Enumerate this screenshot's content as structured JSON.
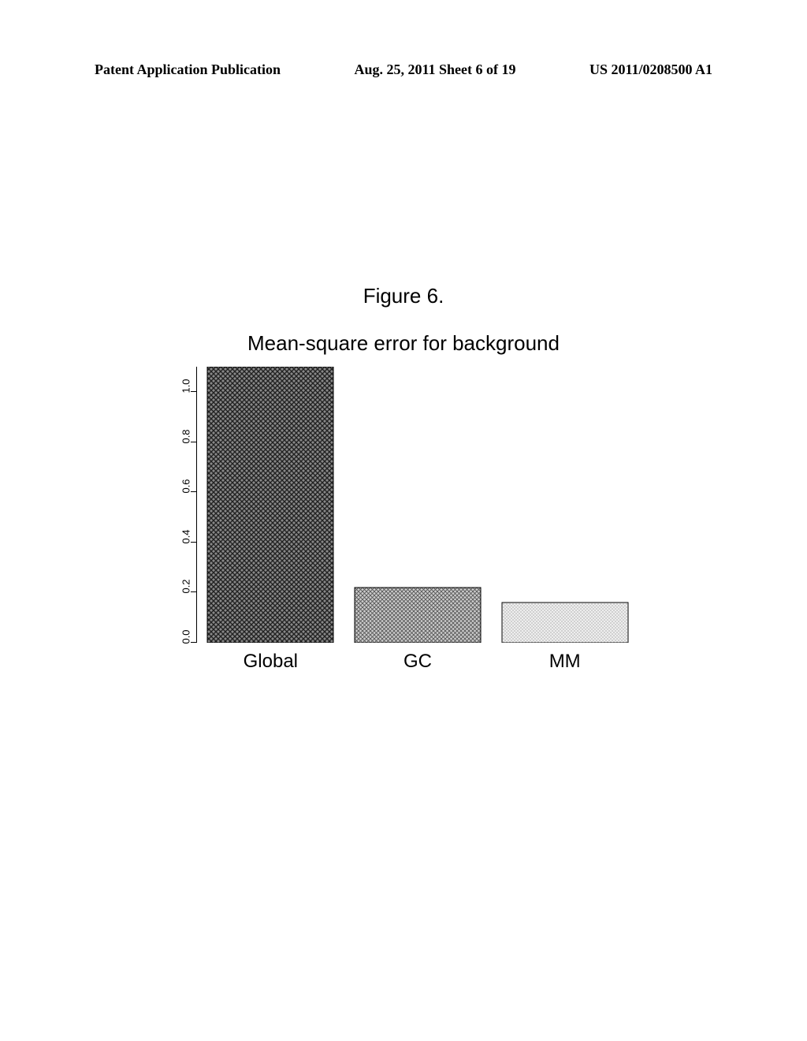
{
  "header": {
    "left": "Patent Application Publication",
    "mid": "Aug. 25, 2011  Sheet 6 of 19",
    "right": "US 2011/0208500 A1"
  },
  "figure_label": "Figure 6.",
  "chart_data": {
    "type": "bar",
    "title": "Mean-square error for background",
    "categories": [
      "Global",
      "GC",
      "MM"
    ],
    "values": [
      1.1,
      0.22,
      0.16
    ],
    "ylim": [
      0.0,
      1.1
    ],
    "yticks": [
      "0.0",
      "0.2",
      "0.4",
      "0.6",
      "0.8",
      "1.0"
    ],
    "xlabel": "",
    "ylabel": ""
  }
}
